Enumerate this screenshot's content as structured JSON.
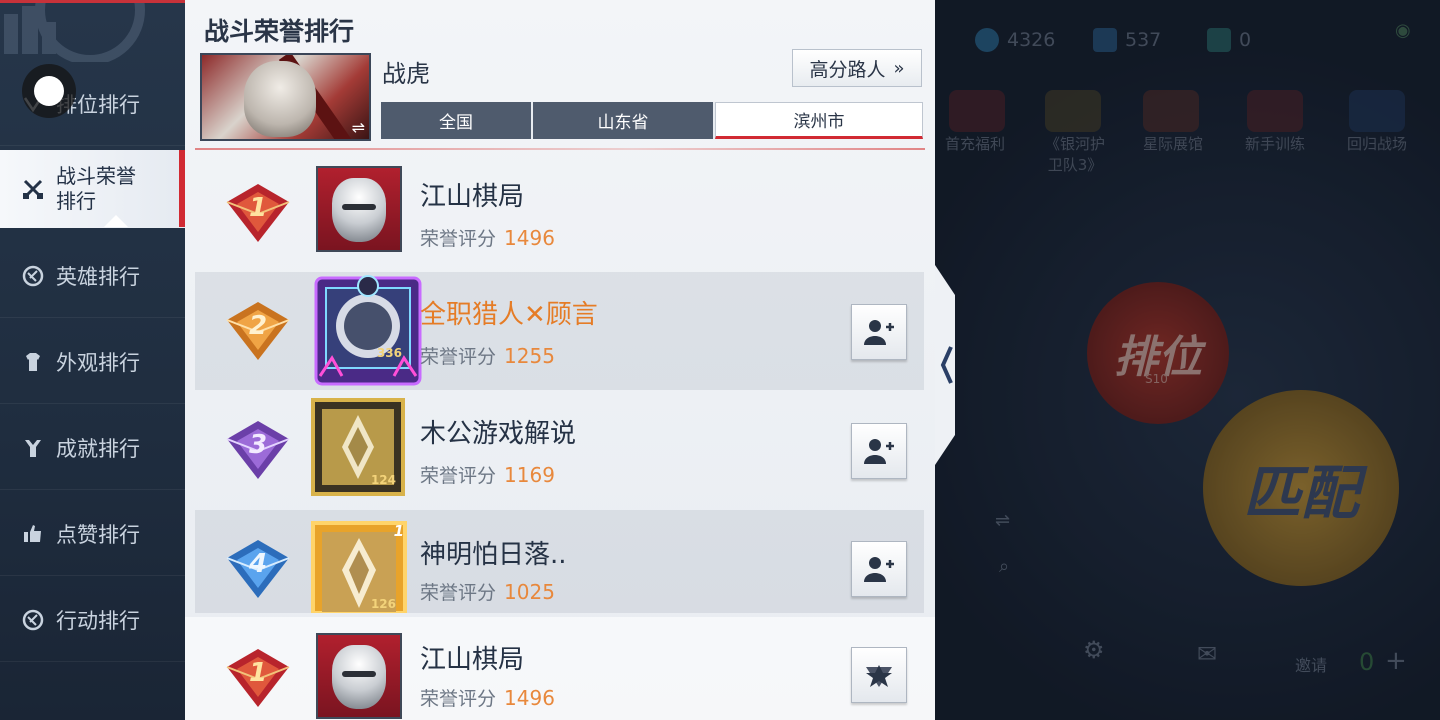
{
  "sidebar": {
    "items": [
      {
        "label": "排位排行",
        "icon": "rank-icon"
      },
      {
        "label": "战斗荣誉\n排行",
        "label_line1": "战斗荣誉",
        "label_line2": "排行",
        "icon": "crossed-swords-icon",
        "active": true
      },
      {
        "label": "英雄排行",
        "icon": "hero-icon"
      },
      {
        "label": "外观排行",
        "icon": "outfit-icon"
      },
      {
        "label": "成就排行",
        "icon": "trophy-icon"
      },
      {
        "label": "点赞排行",
        "icon": "thumbs-up-icon"
      },
      {
        "label": "行动排行",
        "icon": "action-icon"
      }
    ]
  },
  "panel": {
    "title": "战斗荣誉排行",
    "hero_name": "战虎",
    "filter_label": "高分路人",
    "tabs": [
      {
        "label": "全国",
        "active": false
      },
      {
        "label": "山东省",
        "active": false
      },
      {
        "label": "滨州市",
        "active": true
      }
    ]
  },
  "rows": [
    {
      "rank": "1",
      "name": "江山棋局",
      "score_label": "荣誉评分",
      "score": "1496",
      "level": "",
      "name_color": "default",
      "has_add": false
    },
    {
      "rank": "2",
      "name": "全职猎人✕顾言",
      "score_label": "荣誉评分",
      "score": "1255",
      "level": "336",
      "name_color": "orange",
      "has_add": true
    },
    {
      "rank": "3",
      "name": "木公游戏解说",
      "score_label": "荣誉评分",
      "score": "1169",
      "level": "124",
      "name_color": "default",
      "has_add": true
    },
    {
      "rank": "4",
      "name": "神明怕日落..",
      "score_label": "荣誉评分",
      "score": "1025",
      "level": "126",
      "corner": "1",
      "name_color": "default",
      "has_add": true
    }
  ],
  "my_row": {
    "rank": "1",
    "name": "江山棋局",
    "score_label": "荣誉评分",
    "score": "1496"
  },
  "lobby": {
    "stats": [
      "4326",
      "537",
      "0"
    ],
    "menu": [
      "首充福利",
      "《银河护\n卫队3》",
      "星际展馆",
      "新手训练",
      "回归战场"
    ],
    "menu_line1": [
      "首充福利",
      "《银河护",
      "星际展馆",
      "新手训练",
      "回归战场"
    ],
    "menu_line2": [
      "",
      "卫队3》",
      "",
      "",
      ""
    ],
    "ranked_label": "排位",
    "ranked_sub": "S10",
    "match_label": "匹配",
    "invite_label": "邀请",
    "invite_count": "0"
  },
  "colors": {
    "accent_red": "#d12a33",
    "score_orange": "#e8883c",
    "name_orange": "#e57c26"
  }
}
